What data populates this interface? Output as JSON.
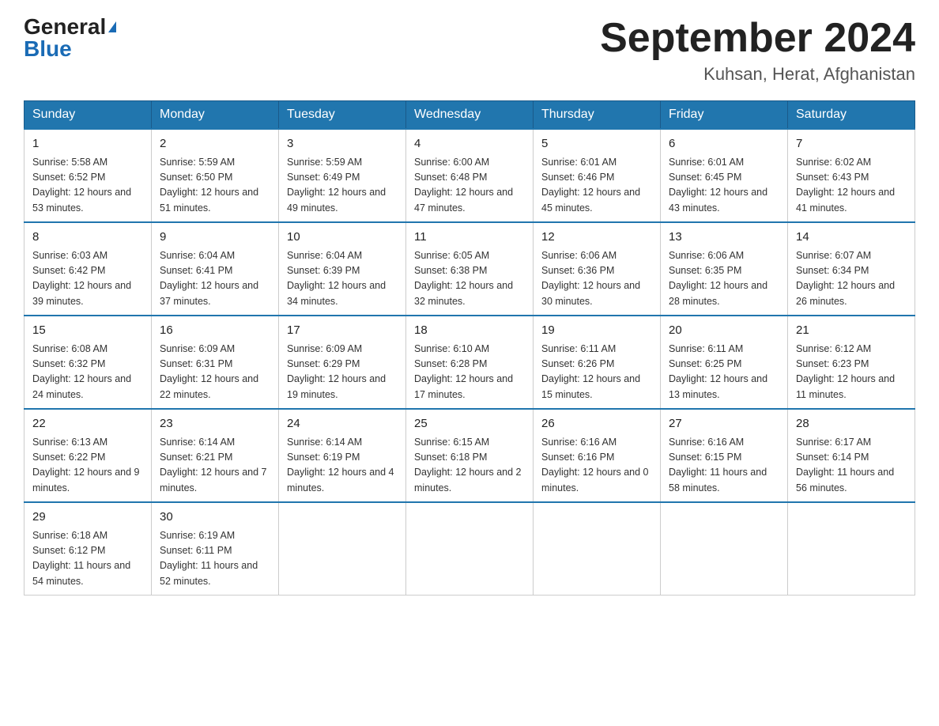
{
  "logo": {
    "general": "General",
    "blue": "Blue"
  },
  "header": {
    "month_year": "September 2024",
    "location": "Kuhsan, Herat, Afghanistan"
  },
  "weekdays": [
    "Sunday",
    "Monday",
    "Tuesday",
    "Wednesday",
    "Thursday",
    "Friday",
    "Saturday"
  ],
  "weeks": [
    [
      {
        "day": "1",
        "sunrise": "5:58 AM",
        "sunset": "6:52 PM",
        "daylight": "12 hours and 53 minutes."
      },
      {
        "day": "2",
        "sunrise": "5:59 AM",
        "sunset": "6:50 PM",
        "daylight": "12 hours and 51 minutes."
      },
      {
        "day": "3",
        "sunrise": "5:59 AM",
        "sunset": "6:49 PM",
        "daylight": "12 hours and 49 minutes."
      },
      {
        "day": "4",
        "sunrise": "6:00 AM",
        "sunset": "6:48 PM",
        "daylight": "12 hours and 47 minutes."
      },
      {
        "day": "5",
        "sunrise": "6:01 AM",
        "sunset": "6:46 PM",
        "daylight": "12 hours and 45 minutes."
      },
      {
        "day": "6",
        "sunrise": "6:01 AM",
        "sunset": "6:45 PM",
        "daylight": "12 hours and 43 minutes."
      },
      {
        "day": "7",
        "sunrise": "6:02 AM",
        "sunset": "6:43 PM",
        "daylight": "12 hours and 41 minutes."
      }
    ],
    [
      {
        "day": "8",
        "sunrise": "6:03 AM",
        "sunset": "6:42 PM",
        "daylight": "12 hours and 39 minutes."
      },
      {
        "day": "9",
        "sunrise": "6:04 AM",
        "sunset": "6:41 PM",
        "daylight": "12 hours and 37 minutes."
      },
      {
        "day": "10",
        "sunrise": "6:04 AM",
        "sunset": "6:39 PM",
        "daylight": "12 hours and 34 minutes."
      },
      {
        "day": "11",
        "sunrise": "6:05 AM",
        "sunset": "6:38 PM",
        "daylight": "12 hours and 32 minutes."
      },
      {
        "day": "12",
        "sunrise": "6:06 AM",
        "sunset": "6:36 PM",
        "daylight": "12 hours and 30 minutes."
      },
      {
        "day": "13",
        "sunrise": "6:06 AM",
        "sunset": "6:35 PM",
        "daylight": "12 hours and 28 minutes."
      },
      {
        "day": "14",
        "sunrise": "6:07 AM",
        "sunset": "6:34 PM",
        "daylight": "12 hours and 26 minutes."
      }
    ],
    [
      {
        "day": "15",
        "sunrise": "6:08 AM",
        "sunset": "6:32 PM",
        "daylight": "12 hours and 24 minutes."
      },
      {
        "day": "16",
        "sunrise": "6:09 AM",
        "sunset": "6:31 PM",
        "daylight": "12 hours and 22 minutes."
      },
      {
        "day": "17",
        "sunrise": "6:09 AM",
        "sunset": "6:29 PM",
        "daylight": "12 hours and 19 minutes."
      },
      {
        "day": "18",
        "sunrise": "6:10 AM",
        "sunset": "6:28 PM",
        "daylight": "12 hours and 17 minutes."
      },
      {
        "day": "19",
        "sunrise": "6:11 AM",
        "sunset": "6:26 PM",
        "daylight": "12 hours and 15 minutes."
      },
      {
        "day": "20",
        "sunrise": "6:11 AM",
        "sunset": "6:25 PM",
        "daylight": "12 hours and 13 minutes."
      },
      {
        "day": "21",
        "sunrise": "6:12 AM",
        "sunset": "6:23 PM",
        "daylight": "12 hours and 11 minutes."
      }
    ],
    [
      {
        "day": "22",
        "sunrise": "6:13 AM",
        "sunset": "6:22 PM",
        "daylight": "12 hours and 9 minutes."
      },
      {
        "day": "23",
        "sunrise": "6:14 AM",
        "sunset": "6:21 PM",
        "daylight": "12 hours and 7 minutes."
      },
      {
        "day": "24",
        "sunrise": "6:14 AM",
        "sunset": "6:19 PM",
        "daylight": "12 hours and 4 minutes."
      },
      {
        "day": "25",
        "sunrise": "6:15 AM",
        "sunset": "6:18 PM",
        "daylight": "12 hours and 2 minutes."
      },
      {
        "day": "26",
        "sunrise": "6:16 AM",
        "sunset": "6:16 PM",
        "daylight": "12 hours and 0 minutes."
      },
      {
        "day": "27",
        "sunrise": "6:16 AM",
        "sunset": "6:15 PM",
        "daylight": "11 hours and 58 minutes."
      },
      {
        "day": "28",
        "sunrise": "6:17 AM",
        "sunset": "6:14 PM",
        "daylight": "11 hours and 56 minutes."
      }
    ],
    [
      {
        "day": "29",
        "sunrise": "6:18 AM",
        "sunset": "6:12 PM",
        "daylight": "11 hours and 54 minutes."
      },
      {
        "day": "30",
        "sunrise": "6:19 AM",
        "sunset": "6:11 PM",
        "daylight": "11 hours and 52 minutes."
      },
      null,
      null,
      null,
      null,
      null
    ]
  ]
}
